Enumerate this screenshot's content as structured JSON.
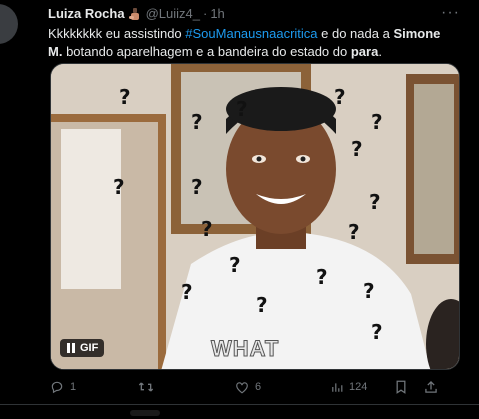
{
  "tweet": {
    "author_name": "Luiza Rocha",
    "author_emoji": "nail-polish-emoji",
    "handle": "@Luiiz4_",
    "separator": "·",
    "time": "1h",
    "more_label": "···",
    "text_part1": "Kkkkkkkk eu assistindo ",
    "hashtag": "#SouManausnaacritica",
    "text_part2": " e do nada a ",
    "bold_name": "Simone M.",
    "text_part3": " botando aparelhagem e a bandeira do estado do ",
    "bold_state": "para",
    "text_part4": "."
  },
  "media": {
    "type": "GIF",
    "badge_label": "GIF",
    "caption": "WHAT",
    "description_icon": "question-marks-meme"
  },
  "actions": {
    "reply_count": "1",
    "retweet_count": "",
    "like_count": "6",
    "views_count": "124"
  },
  "colors": {
    "background": "#000000",
    "text": "#e7e9ea",
    "muted": "#71767b",
    "link": "#1d9bf0",
    "border": "#2f3336"
  }
}
